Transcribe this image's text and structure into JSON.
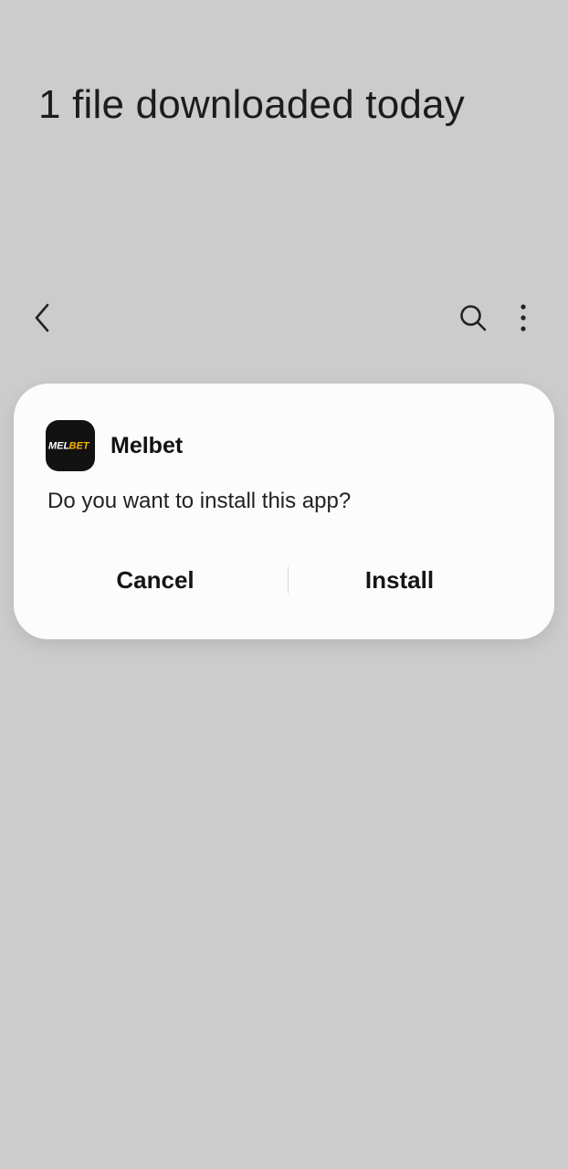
{
  "page": {
    "title": "1 file downloaded today"
  },
  "toolbar": {
    "back_icon": "chevron-left-icon",
    "search_icon": "search-icon",
    "more_icon": "more-vertical-icon"
  },
  "dialog": {
    "app_name": "Melbet",
    "app_icon": {
      "name": "melbet-logo-icon",
      "logo_text": "MELBET",
      "colors": {
        "background": "#121212",
        "text_white": "#ffffff",
        "text_yellow": "#f5b400"
      }
    },
    "question": "Do you want to install this app?",
    "cancel_label": "Cancel",
    "install_label": "Install"
  },
  "colors": {
    "background": "#cccccc",
    "dialog_background": "#fcfcfc",
    "text": "#1a1a1a"
  }
}
